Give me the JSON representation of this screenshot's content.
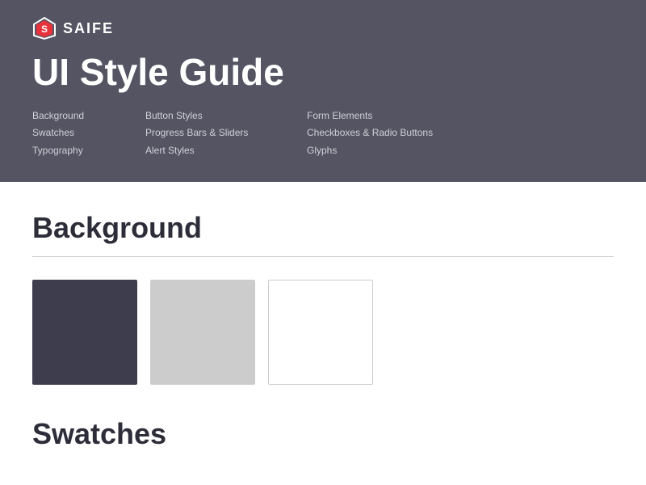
{
  "header": {
    "logo_text": "SAIFE",
    "page_title": "UI Style Guide",
    "nav": {
      "col1": [
        {
          "label": "Background"
        },
        {
          "label": "Swatches"
        },
        {
          "label": "Typography"
        }
      ],
      "col2": [
        {
          "label": "Button Styles"
        },
        {
          "label": "Progress Bars & Sliders"
        },
        {
          "label": "Alert Styles"
        }
      ],
      "col3": [
        {
          "label": "Form Elements"
        },
        {
          "label": "Checkboxes & Radio Buttons"
        },
        {
          "label": "Glyphs"
        }
      ]
    }
  },
  "background_section": {
    "title": "Background",
    "swatches": [
      {
        "name": "dark",
        "color": "#3d3d4e"
      },
      {
        "name": "light-gray",
        "color": "#cccccc"
      },
      {
        "name": "white",
        "color": "#ffffff"
      }
    ]
  },
  "swatches_section": {
    "title": "Swatches"
  }
}
